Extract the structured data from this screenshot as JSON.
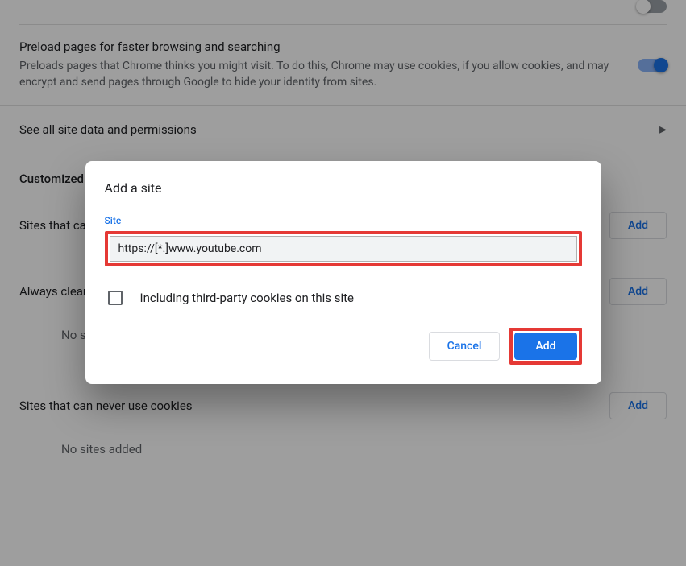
{
  "preload": {
    "title": "Preload pages for faster browsing and searching",
    "desc": "Preloads pages that Chrome thinks you might visit. To do this, Chrome may use cookies, if you allow cookies, and may encrypt and send pages through Google to hide your identity from sites."
  },
  "link_site_data": "See all site data and permissions",
  "custom_heading": "Customized behaviors",
  "groups": {
    "allow": {
      "title": "Sites that can always use cookies",
      "add": "Add"
    },
    "clear": {
      "title": "Always clear cookies when windows are closed",
      "add": "Add",
      "empty": "No sites added"
    },
    "block": {
      "title": "Sites that can never use cookies",
      "add": "Add",
      "empty": "No sites added"
    }
  },
  "dialog": {
    "title": "Add a site",
    "field_label": "Site",
    "site_value": "https://[*.]www.youtube.com",
    "cbx_label": "Including third-party cookies on this site",
    "cancel": "Cancel",
    "add": "Add"
  }
}
